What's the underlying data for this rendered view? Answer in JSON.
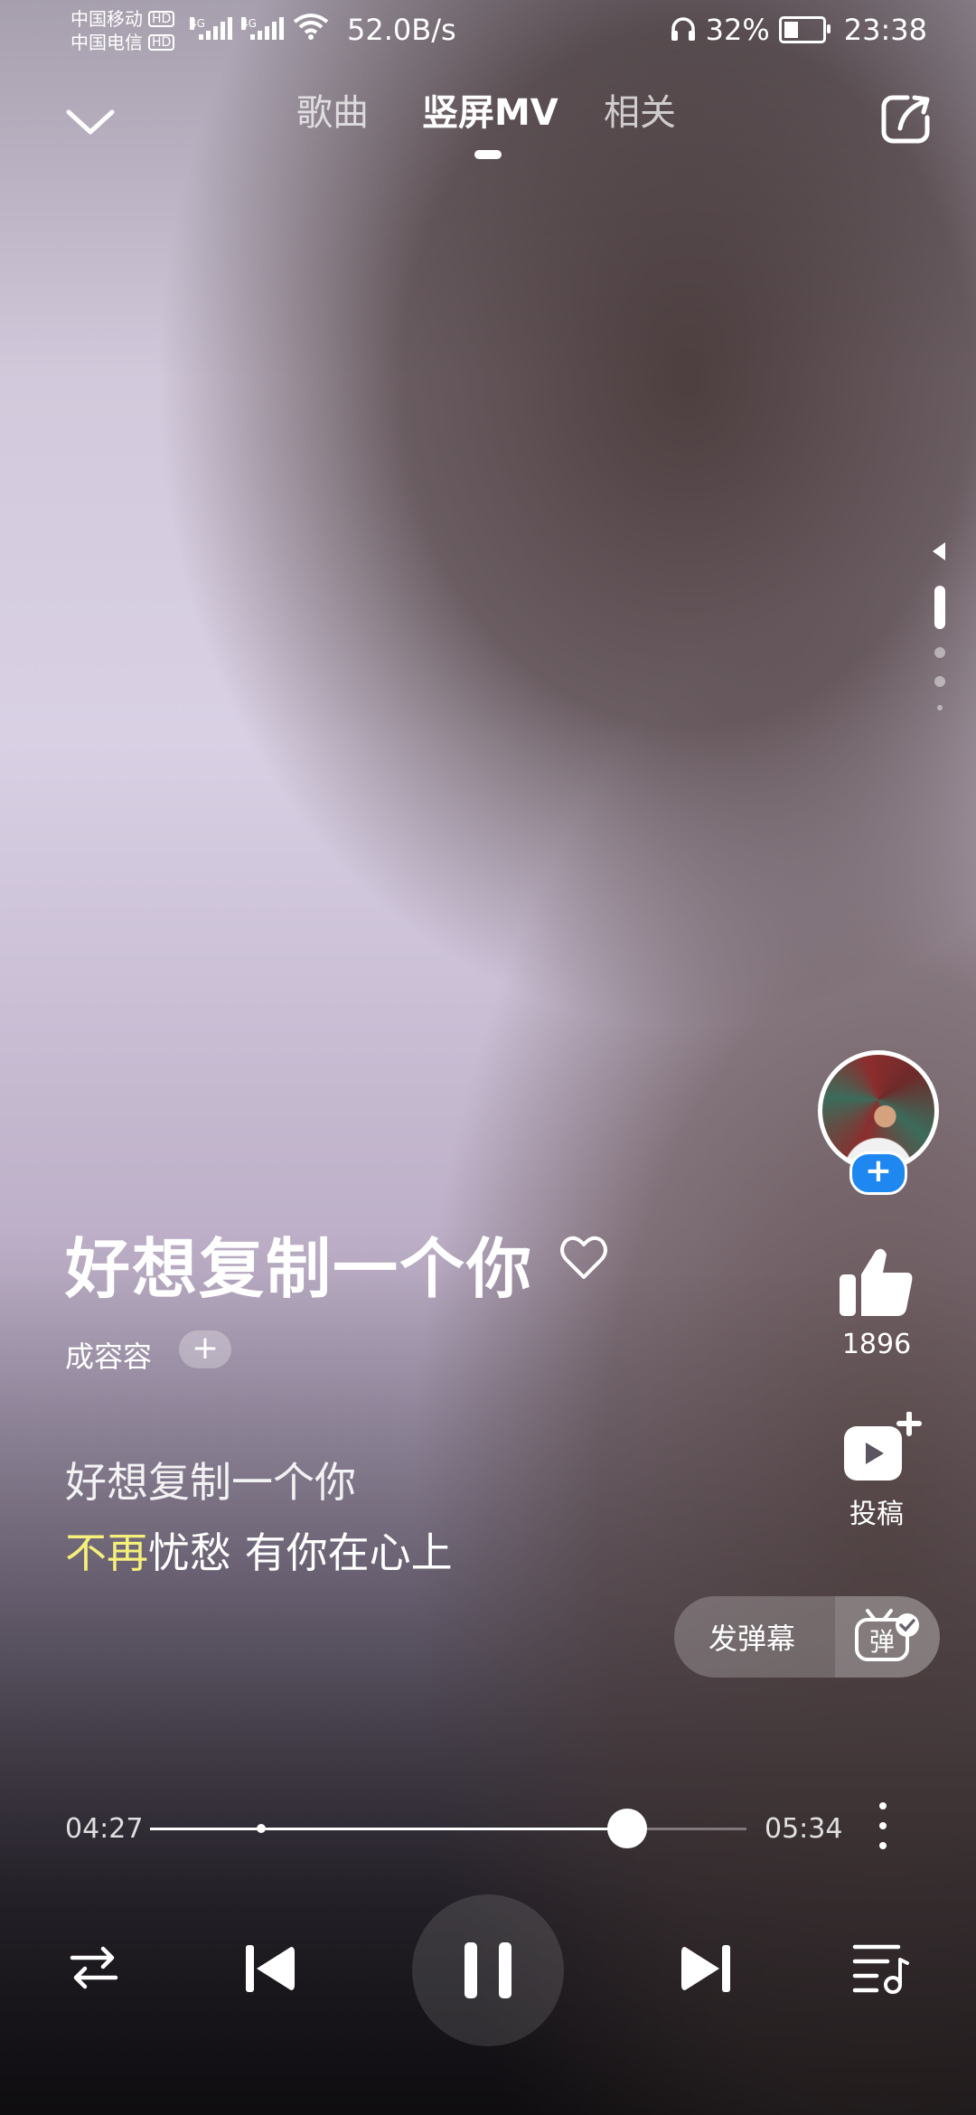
{
  "status_bar": {
    "carrier_1": "中国移动",
    "carrier_2": "中国电信",
    "hd_label": "HD",
    "network": "4G",
    "speed": "52.0B/s",
    "battery": "32%",
    "battery_level": 0.32,
    "time": "23:38"
  },
  "nav": {
    "tabs": [
      "歌曲",
      "竖屏MV",
      "相关"
    ],
    "active_tab": "竖屏MV",
    "back_icon": "chevron-down-icon",
    "share_icon": "share-icon"
  },
  "song": {
    "title": "好想复制一个你",
    "artist": "成容容",
    "follow_label": "+",
    "favorite_icon": "heart-outline-icon"
  },
  "lyrics": {
    "line1": "好想复制一个你",
    "line2_highlight": "不再",
    "line2_rest": "忧愁 有你在心上"
  },
  "side": {
    "avatar_plus": "+",
    "like_count": "1896",
    "like_icon": "thumbs-up-icon",
    "submit_label": "投稿",
    "submit_icon": "video-add-icon"
  },
  "danmaku": {
    "label": "发弹幕",
    "icon_text": "弹"
  },
  "player": {
    "current_time": "04:27",
    "total_time": "05:34",
    "progress": 0.7997
  },
  "colors": {
    "accent_blue": "#1e88f0",
    "lyric_highlight": "#f4f07a"
  }
}
